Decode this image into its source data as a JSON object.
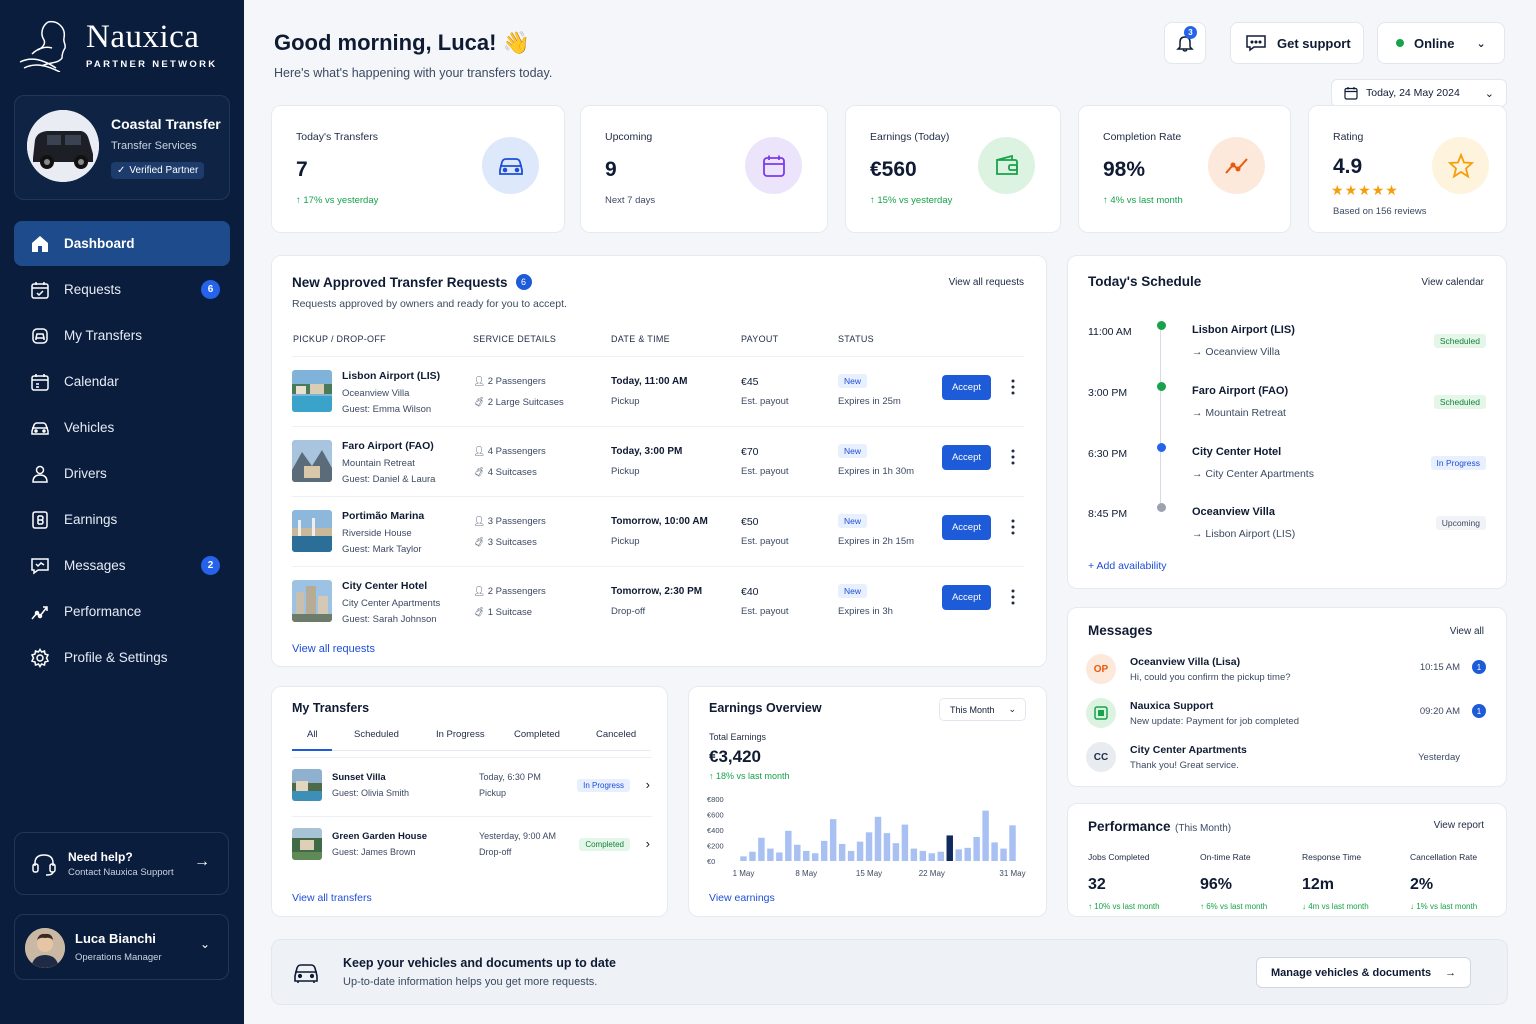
{
  "brand": {
    "name": "Nauxica",
    "tagline": "PARTNER NETWORK"
  },
  "company": {
    "name": "Coastal Transfer",
    "type": "Transfer Services",
    "badge": "Verified Partner"
  },
  "nav": [
    {
      "label": "Dashboard",
      "icon": "home-icon",
      "active": true
    },
    {
      "label": "Requests",
      "icon": "calendar-check-icon",
      "badge": "6"
    },
    {
      "label": "My Transfers",
      "icon": "car-transfer-icon"
    },
    {
      "label": "Calendar",
      "icon": "calendar-icon"
    },
    {
      "label": "Vehicles",
      "icon": "car-icon"
    },
    {
      "label": "Drivers",
      "icon": "user-icon"
    },
    {
      "label": "Earnings",
      "icon": "document-icon"
    },
    {
      "label": "Messages",
      "icon": "chat-icon",
      "badge": "2"
    },
    {
      "label": "Performance",
      "icon": "trend-icon"
    },
    {
      "label": "Profile & Settings",
      "icon": "gear-icon"
    }
  ],
  "help": {
    "title": "Need help?",
    "subtitle": "Contact Nauxica Support"
  },
  "user": {
    "name": "Luca Bianchi",
    "role": "Operations Manager"
  },
  "header": {
    "greeting": "Good morning, Luca! 👋",
    "subtitle": "Here's what's happening with your transfers today.",
    "notifications": "3",
    "support": "Get support",
    "status": "Online",
    "date": "Today, 24 May 2024"
  },
  "stats": [
    {
      "label": "Today's Transfers",
      "value": "7",
      "sub": "17% vs yesterday",
      "trend": "up"
    },
    {
      "label": "Upcoming",
      "value": "9",
      "sub": "Next 7 days"
    },
    {
      "label": "Earnings (Today)",
      "value": "€560",
      "sub": "15% vs yesterday",
      "trend": "up"
    },
    {
      "label": "Completion Rate",
      "value": "98%",
      "sub": "4% vs last month",
      "trend": "up"
    },
    {
      "label": "Rating",
      "value": "4.9",
      "sub": "Based on 156 reviews",
      "stars": 5
    }
  ],
  "requests": {
    "title": "New Approved Transfer Requests",
    "count": "6",
    "subtitle": "Requests approved by owners and ready for you to accept.",
    "view_all": "View all requests",
    "view_all_bottom": "View all requests",
    "columns": [
      "PICKUP / DROP-OFF",
      "SERVICE DETAILS",
      "DATE & TIME",
      "PAYOUT",
      "STATUS"
    ],
    "rows": [
      {
        "place": "Lisbon Airport (LIS)",
        "dest": "Oceanview Villa",
        "guest": "Guest: Emma Wilson",
        "pax": "2 Passengers",
        "bags": "2 Large Suitcases",
        "when": "Today, 11:00 AM",
        "kind": "Pickup",
        "payout": "€45",
        "payout_sub": "Est. payout",
        "status": "New",
        "expires": "Expires in 25m",
        "action": "Accept"
      },
      {
        "place": "Faro Airport (FAO)",
        "dest": "Mountain Retreat",
        "guest": "Guest: Daniel & Laura",
        "pax": "4 Passengers",
        "bags": "4 Suitcases",
        "when": "Today, 3:00 PM",
        "kind": "Pickup",
        "payout": "€70",
        "payout_sub": "Est. payout",
        "status": "New",
        "expires": "Expires in 1h 30m",
        "action": "Accept"
      },
      {
        "place": "Portimão Marina",
        "dest": "Riverside House",
        "guest": "Guest: Mark Taylor",
        "pax": "3 Passengers",
        "bags": "3 Suitcases",
        "when": "Tomorrow, 10:00 AM",
        "kind": "Pickup",
        "payout": "€50",
        "payout_sub": "Est. payout",
        "status": "New",
        "expires": "Expires in 2h 15m",
        "action": "Accept"
      },
      {
        "place": "City Center Hotel",
        "dest": "City Center Apartments",
        "guest": "Guest: Sarah Johnson",
        "pax": "2 Passengers",
        "bags": "1 Suitcase",
        "when": "Tomorrow, 2:30 PM",
        "kind": "Drop-off",
        "payout": "€40",
        "payout_sub": "Est. payout",
        "status": "New",
        "expires": "Expires in 3h",
        "action": "Accept"
      }
    ]
  },
  "schedule": {
    "title": "Today's Schedule",
    "view": "View calendar",
    "add": "+ Add availability",
    "items": [
      {
        "time": "11:00 AM",
        "place": "Lisbon Airport (LIS)",
        "dest": "Oceanview Villa",
        "status": "Scheduled",
        "color": "#16a34a"
      },
      {
        "time": "3:00 PM",
        "place": "Faro Airport (FAO)",
        "dest": "Mountain Retreat",
        "status": "Scheduled",
        "color": "#16a34a"
      },
      {
        "time": "6:30 PM",
        "place": "City Center Hotel",
        "dest": "City Center Apartments",
        "status": "In Progress",
        "color": "#2563eb"
      },
      {
        "time": "8:45 PM",
        "place": "Oceanview Villa",
        "dest": "Lisbon Airport (LIS)",
        "status": "Upcoming",
        "color": "#9ca3af"
      }
    ]
  },
  "messages": {
    "title": "Messages",
    "view": "View all",
    "items": [
      {
        "initials": "OP",
        "name": "Oceanview Villa (Lisa)",
        "text": "Hi, could you confirm the pickup time?",
        "time": "10:15 AM",
        "unread": "1"
      },
      {
        "initials": "",
        "name": "Nauxica Support",
        "text": "New update: Payment for job completed",
        "time": "09:20 AM",
        "unread": "1"
      },
      {
        "initials": "CC",
        "name": "City Center Apartments",
        "text": "Thank you! Great service.",
        "time": "Yesterday",
        "unread": ""
      }
    ]
  },
  "my_transfers": {
    "title": "My Transfers",
    "tabs": [
      "All",
      "Scheduled",
      "In Progress",
      "Completed",
      "Canceled"
    ],
    "rows": [
      {
        "place": "Sunset Villa",
        "guest": "Guest: Olivia Smith",
        "when": "Today, 6:30 PM",
        "kind": "Pickup",
        "status": "In Progress"
      },
      {
        "place": "Green Garden House",
        "guest": "Guest: James Brown",
        "when": "Yesterday, 9:00 AM",
        "kind": "Drop-off",
        "status": "Completed"
      }
    ],
    "view": "View all transfers"
  },
  "earnings": {
    "title": "Earnings Overview",
    "period": "This Month",
    "total_label": "Total Earnings",
    "total": "€3,420",
    "change": "18% vs last month",
    "view": "View earnings"
  },
  "chart_data": {
    "type": "bar",
    "x": [
      "1 May",
      "2 May",
      "3 May",
      "4 May",
      "5 May",
      "6 May",
      "7 May",
      "8 May",
      "9 May",
      "10 May",
      "11 May",
      "12 May",
      "13 May",
      "14 May",
      "15 May",
      "16 May",
      "17 May",
      "18 May",
      "19 May",
      "20 May",
      "21 May",
      "22 May",
      "23 May",
      "24 May",
      "25 May",
      "26 May",
      "27 May",
      "28 May",
      "29 May",
      "30 May",
      "31 May"
    ],
    "values": [
      60,
      120,
      300,
      160,
      110,
      390,
      210,
      130,
      100,
      260,
      540,
      220,
      130,
      250,
      370,
      570,
      360,
      230,
      470,
      160,
      130,
      100,
      120,
      330,
      150,
      170,
      310,
      650,
      240,
      160,
      460
    ],
    "highlight_index": 23,
    "tick_labels_x": [
      "1 May",
      "8 May",
      "15 May",
      "22 May",
      "31 May"
    ],
    "ytick_labels": [
      "€800",
      "€600",
      "€400",
      "€200",
      "€0"
    ],
    "ylim": [
      0,
      800
    ],
    "colors": {
      "bar": "#a9c1f2",
      "highlight": "#0f2a5c"
    }
  },
  "performance": {
    "title": "Performance",
    "period": "(This Month)",
    "view": "View report",
    "metrics": [
      {
        "label": "Jobs Completed",
        "value": "32",
        "sub": "10% vs last month",
        "trend": "up"
      },
      {
        "label": "On-time Rate",
        "value": "96%",
        "sub": "6% vs last month",
        "trend": "up"
      },
      {
        "label": "Response Time",
        "value": "12m",
        "sub": "4m vs last month",
        "trend": "down"
      },
      {
        "label": "Cancellation Rate",
        "value": "2%",
        "sub": "1% vs last month",
        "trend": "down"
      }
    ]
  },
  "banner": {
    "title": "Keep your vehicles and documents up to date",
    "subtitle": "Up-to-date information helps you get more requests.",
    "button": "Manage vehicles & documents"
  }
}
